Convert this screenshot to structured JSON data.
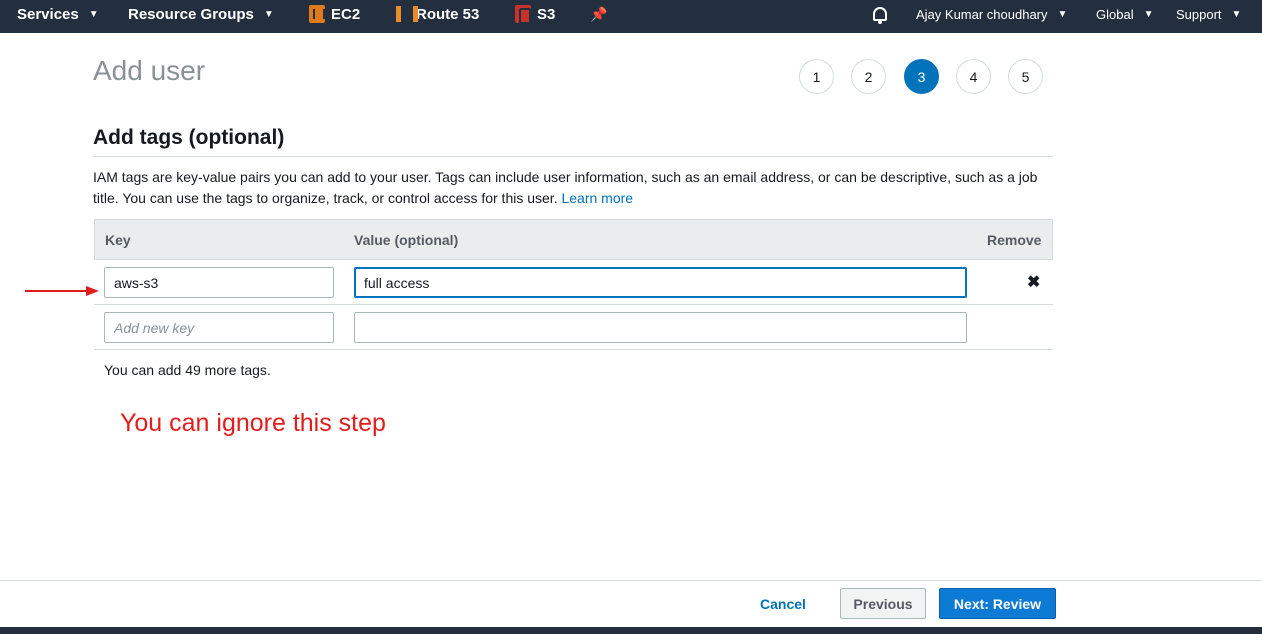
{
  "topnav": {
    "services": "Services",
    "resource_groups": "Resource Groups",
    "shortcuts": [
      {
        "label": "EC2",
        "icon": "ec2-icon"
      },
      {
        "label": "Route 53",
        "icon": "route53-icon"
      },
      {
        "label": "S3",
        "icon": "s3-icon"
      }
    ],
    "pin_icon": "pin-icon",
    "bell_icon": "bell-icon",
    "user": "Ajay Kumar choudhary",
    "region": "Global",
    "support": "Support"
  },
  "page": {
    "title": "Add user",
    "steps": [
      "1",
      "2",
      "3",
      "4",
      "5"
    ],
    "active_step": "3"
  },
  "section": {
    "title": "Add tags (optional)",
    "description": "IAM tags are key-value pairs you can add to your user. Tags can include user information, such as an email address, or can be descriptive, such as a job title. You can use the tags to organize, track, or control access for this user.",
    "learn_more": "Learn more"
  },
  "table": {
    "headers": {
      "key": "Key",
      "value": "Value (optional)",
      "remove": "Remove"
    },
    "rows": [
      {
        "key": "aws-s3",
        "value": "full access"
      }
    ],
    "new_row": {
      "key_placeholder": "Add new key",
      "value": ""
    },
    "remove_icon": "close-icon"
  },
  "count_note": "You can add 49 more tags.",
  "annotation": "You can ignore this step",
  "colors": {
    "nav_bg": "#232f3e",
    "primary": "#0d7bd6",
    "link": "#0073bb",
    "annotation": "#e21d1d"
  },
  "footer": {
    "cancel": "Cancel",
    "previous": "Previous",
    "next": "Next: Review"
  }
}
